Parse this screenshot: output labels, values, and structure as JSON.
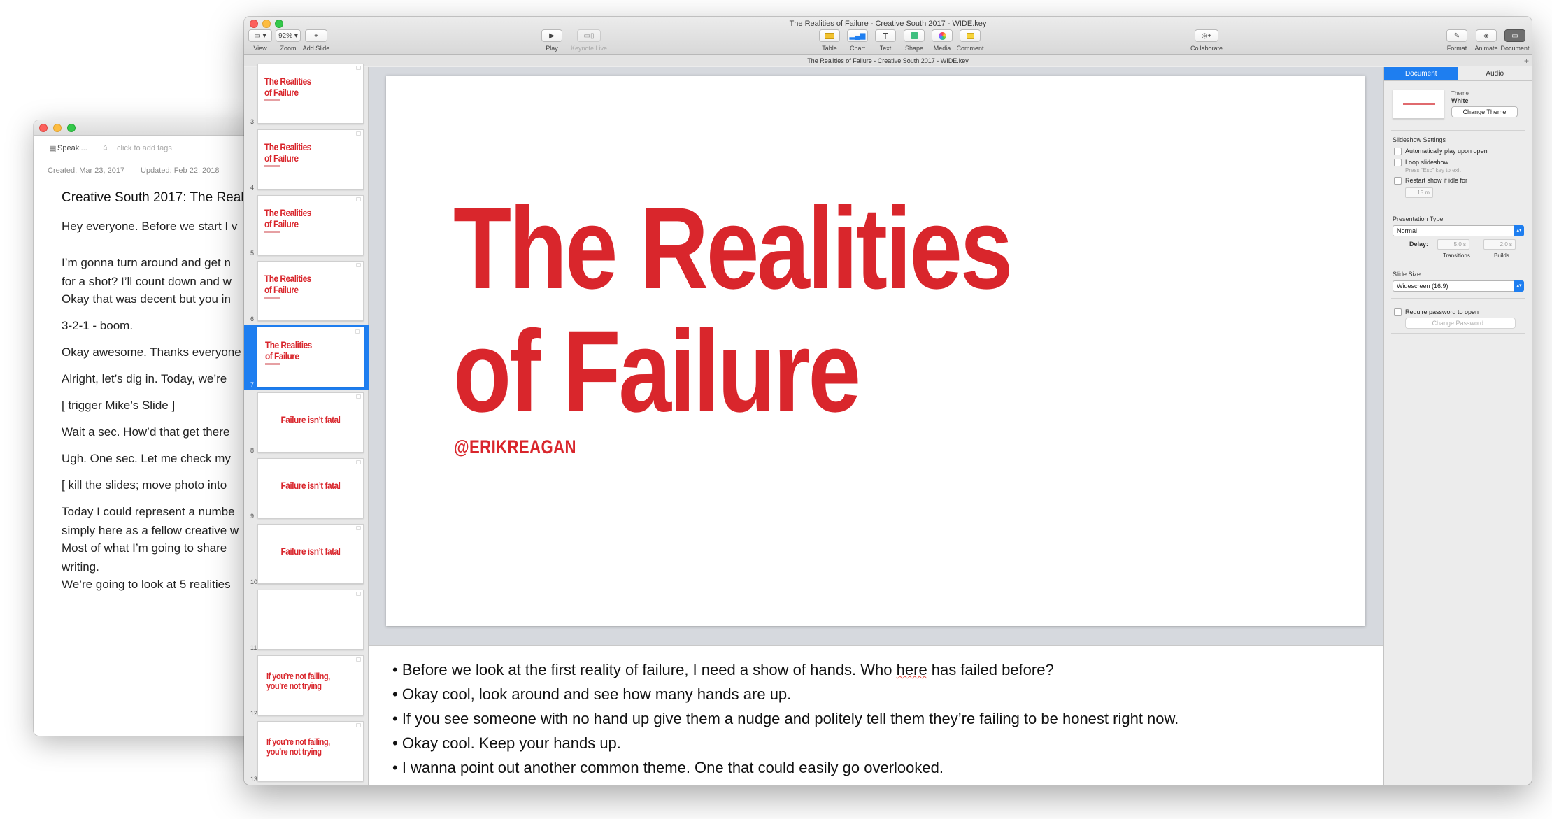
{
  "notes_window": {
    "doc_name": "Speaki...",
    "tags_placeholder": "click to add tags",
    "created": "Created: Mar 23, 2017",
    "updated": "Updated: Feb 22, 2018",
    "title": "Creative South 2017: The Real",
    "paragraphs": [
      "Hey everyone. Before we start I v",
      "I’m gonna turn around and get n\nfor a shot? I’ll count down and w",
      "Okay that was decent but you in",
      "3-2-1 - boom.",
      "Okay awesome. Thanks everyone",
      "Alright, let’s dig in. Today, we’re",
      "[ trigger Mike’s Slide ]",
      "Wait a sec. How’d that get there",
      "Ugh. One sec. Let me check my",
      "[ kill the slides; move photo into",
      "Today I could represent a numbe\nsimply here as a fellow creative w",
      "Most of what I’m going to share\nwriting.",
      "We’re going to look at 5 realities"
    ]
  },
  "keynote": {
    "window_title": "The Realities of Failure - Creative South 2017 - WIDE.key",
    "doc_tab": "The Realities of Failure - Creative South 2017 - WIDE.key",
    "toolbar": {
      "view": "View",
      "zoom_value": "92%",
      "zoom": "Zoom",
      "add_slide": "Add Slide",
      "play": "Play",
      "keynote_live": "Keynote Live",
      "table": "Table",
      "chart": "Chart",
      "text": "Text",
      "shape": "Shape",
      "media": "Media",
      "comment": "Comment",
      "collaborate": "Collaborate",
      "format": "Format",
      "animate": "Animate",
      "document": "Document"
    },
    "slides": [
      {
        "num": "3",
        "text": "The Realities\nof Failure",
        "sub": true
      },
      {
        "num": "4",
        "text": "The Realities\nof Failure",
        "sub": true
      },
      {
        "num": "5",
        "text": "The Realities\nof Failure",
        "sub": true
      },
      {
        "num": "6",
        "text": "The Realities\nof Failure",
        "sub": true
      },
      {
        "num": "7",
        "text": "The Realities\nof Failure",
        "sub": true,
        "selected": true
      },
      {
        "num": "8",
        "text": "Failure isn’t fatal"
      },
      {
        "num": "9",
        "text": "Failure isn’t fatal"
      },
      {
        "num": "10",
        "text": "Failure isn’t fatal"
      },
      {
        "num": "11",
        "text": ""
      },
      {
        "num": "12",
        "text": "If you’re not failing,\nyou’re not trying"
      },
      {
        "num": "13",
        "text": "If you’re not failing,\nyou’re not trying"
      }
    ],
    "current_slide": {
      "title_line1": "The Realities",
      "title_line2": "of Failure",
      "handle": "@ERIKREAGAN"
    },
    "presenter_notes": [
      {
        "pre": "• Before we look at the first reality of failure, I need a show of hands. Who ",
        "flag": "here",
        "post": " has failed before?"
      },
      {
        "pre": "• Okay cool, look around and see how many hands are up."
      },
      {
        "pre": "• If you see someone with no hand up give them a nudge and politely tell them they’re failing to be honest right now."
      },
      {
        "pre": "• Okay cool. Keep your hands up."
      },
      {
        "pre": "• I wanna point out another common theme. One that could easily go overlooked."
      }
    ],
    "inspector": {
      "tab_document": "Document",
      "tab_audio": "Audio",
      "theme_label": "Theme",
      "theme_name": "White",
      "change_theme": "Change Theme",
      "slideshow_settings": "Slideshow Settings",
      "auto_play": "Automatically play upon open",
      "loop": "Loop slideshow",
      "loop_hint": "Press “Esc” key to exit",
      "restart_idle": "Restart show if idle for",
      "idle_value": "15 m",
      "presentation_type": "Presentation Type",
      "presentation_value": "Normal",
      "delay": "Delay:",
      "transitions_value": "5.0 s",
      "builds_value": "2.0 s",
      "transitions": "Transitions",
      "builds": "Builds",
      "slide_size": "Slide Size",
      "slide_size_value": "Widescreen (16:9)",
      "require_password": "Require password to open",
      "change_password": "Change Password..."
    },
    "colors": {
      "accent": "#d9262c",
      "selection": "#1e7ef0"
    }
  }
}
